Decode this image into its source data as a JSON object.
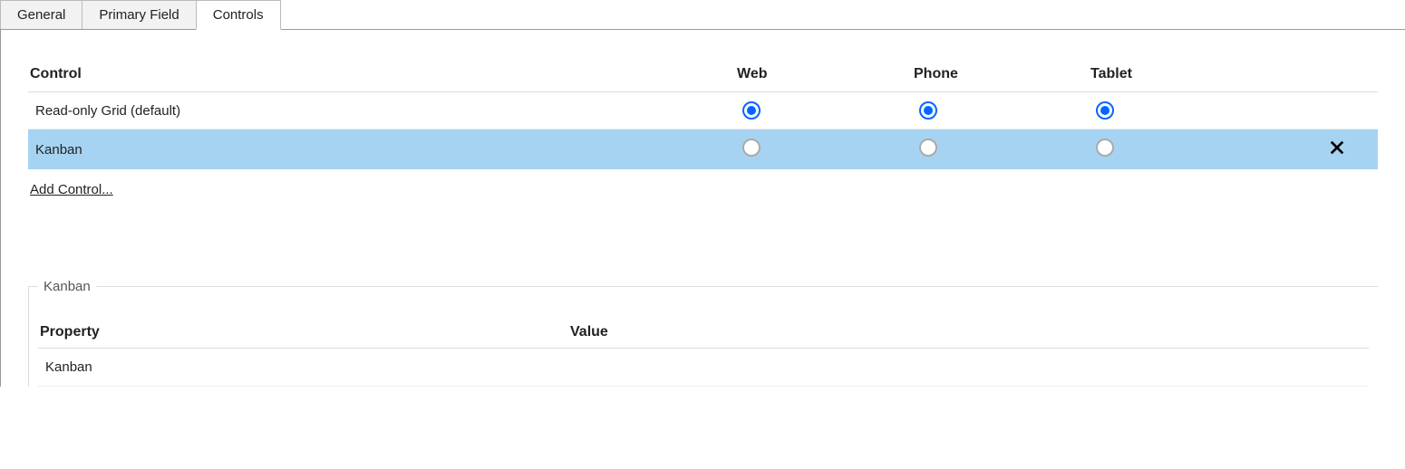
{
  "tabs": {
    "general": "General",
    "primary_field": "Primary Field",
    "controls": "Controls"
  },
  "controls_table": {
    "headers": {
      "control": "Control",
      "web": "Web",
      "phone": "Phone",
      "tablet": "Tablet"
    },
    "rows": [
      {
        "name": "Read-only Grid (default)",
        "web": true,
        "phone": true,
        "tablet": true,
        "selected": false,
        "removable": false
      },
      {
        "name": "Kanban",
        "web": false,
        "phone": false,
        "tablet": false,
        "selected": true,
        "removable": true
      }
    ],
    "add_link": "Add Control..."
  },
  "properties": {
    "legend": "Kanban",
    "headers": {
      "property": "Property",
      "value": "Value"
    },
    "rows": [
      {
        "property": "Kanban",
        "value": ""
      }
    ]
  }
}
